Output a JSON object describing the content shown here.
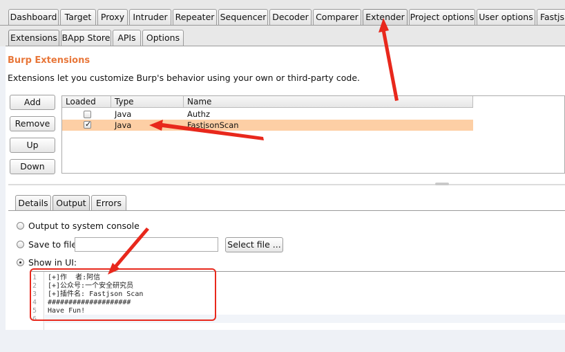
{
  "main_tabs": [
    "Dashboard",
    "Target",
    "Proxy",
    "Intruder",
    "Repeater",
    "Sequencer",
    "Decoder",
    "Comparer",
    "Extender",
    "Project options",
    "User options",
    "Fastjs"
  ],
  "sub_tabs": [
    "Extensions",
    "BApp Store",
    "APIs",
    "Options"
  ],
  "section": {
    "title": "Burp Extensions",
    "description": "Extensions let you customize Burp's behavior using your own or third-party code."
  },
  "buttons": {
    "add": "Add",
    "remove": "Remove",
    "up": "Up",
    "down": "Down"
  },
  "table": {
    "columns": [
      "Loaded",
      "Type",
      "Name"
    ],
    "rows": [
      {
        "loaded": false,
        "type": "Java",
        "name": "Authz"
      },
      {
        "loaded": true,
        "type": "Java",
        "name": "FastjsonScan"
      }
    ],
    "selected_row_color": "#fdcfa5"
  },
  "detail_tabs": [
    "Details",
    "Output",
    "Errors"
  ],
  "output": {
    "option_console": "Output to system console",
    "option_file": "Save to file:",
    "file_value": "",
    "select_file": "Select file ...",
    "option_ui": "Show in UI:",
    "lines": [
      "[+]作  者:阿信",
      "[+]公众号:一个安全研究员",
      "[+]插件名: Fastjson Scan",
      "####################",
      "Have Fun!",
      ""
    ],
    "line_numbers": [
      "1",
      "2",
      "3",
      "4",
      "5",
      "6"
    ]
  },
  "colors": {
    "accent": "#e8773a",
    "annotation": "#e8281c"
  }
}
